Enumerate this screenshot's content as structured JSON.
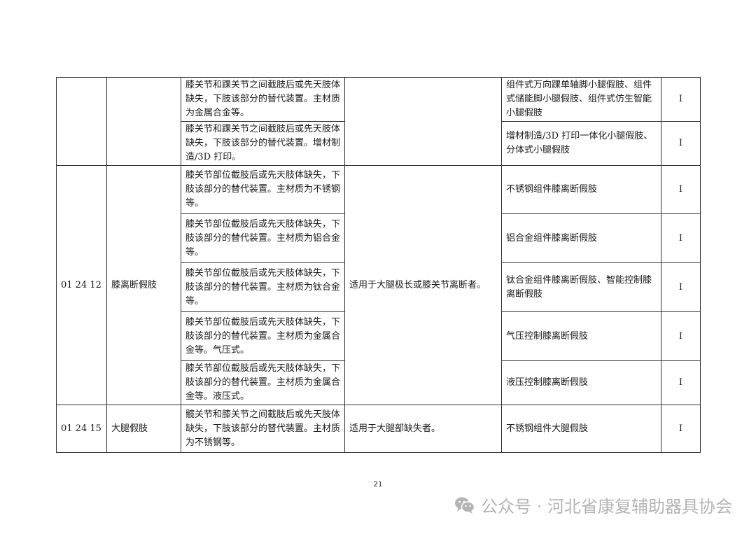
{
  "table": {
    "rows": [
      {
        "code": "",
        "name": "",
        "usage": "",
        "items": [
          {
            "description": "膝关节和踝关节之间截肢后或先天肢体缺失，下肢该部分的替代装置。主材质为金属合金等。",
            "example": "组件式万向踝单轴脚小腿假肢、组件式储能脚小腿假肢、组件式仿生智能小腿假肢",
            "class": "I"
          },
          {
            "description": "膝关节和踝关节之间截肢后或先天肢体缺失，下肢该部分的替代装置。增材制造/3D 打印。",
            "example": "增材制造/3D 打印一体化小腿假肢、分体式小腿假肢",
            "class": "I"
          }
        ]
      },
      {
        "code": "01 24 12",
        "name": "膝离断假肢",
        "usage": "适用于大腿极长或膝关节离断者。",
        "items": [
          {
            "description": "膝关节部位截肢后或先天肢体缺失，下肢该部分的替代装置。主材质为不锈钢等。",
            "example": "不锈钢组件膝离断假肢",
            "class": "I"
          },
          {
            "description": "膝关节部位截肢后或先天肢体缺失，下肢该部分的替代装置。主材质为铝合金等。",
            "example": "铝合金组件膝离断假肢",
            "class": "I"
          },
          {
            "description": "膝关节部位截肢后或先天肢体缺失，下肢该部分的替代装置。主材质为钛合金等。",
            "example": "钛合金组件膝离断假肢、智能控制膝离断假肢",
            "class": "I"
          },
          {
            "description": "膝关节部位截肢后或先天肢体缺失，下肢该部分的替代装置。主材质为金属合金等。气压式。",
            "example": "气压控制膝离断假肢",
            "class": "I"
          },
          {
            "description": "膝关节部位截肢后或先天肢体缺失，下肢该部分的替代装置。主材质为金属合金等。液压式。",
            "example": "液压控制膝离断假肢",
            "class": "I"
          }
        ]
      },
      {
        "code": "01 24 15",
        "name": "大腿假肢",
        "usage": "适用于大腿部缺失者。",
        "items": [
          {
            "description": "髋关节和膝关节之间截肢后或先天肢体缺失，下肢该部分的替代装置。主材质为不锈钢等。",
            "example": "不锈钢组件大腿假肢",
            "class": "I"
          }
        ]
      }
    ]
  },
  "page_number": "21",
  "watermark": {
    "text": "公众号 · 河北省康复辅助器具协会",
    "icon": "wechat-icon"
  }
}
